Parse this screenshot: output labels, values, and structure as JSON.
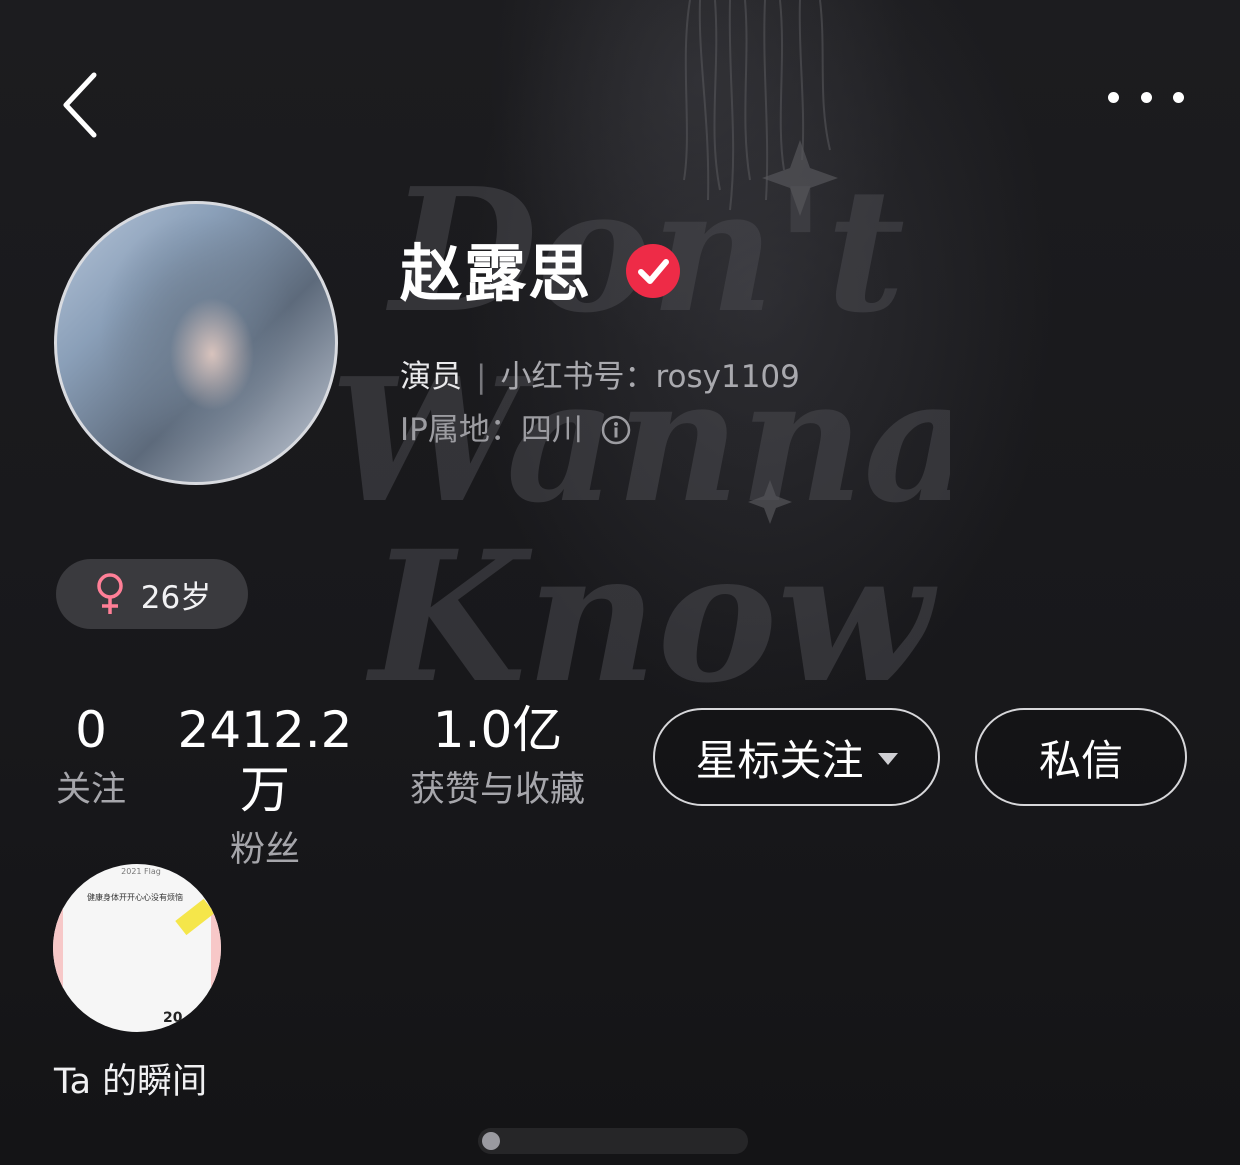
{
  "profile": {
    "name": "赵露思",
    "role": "演员",
    "id_label": "小红书号：",
    "id_value": "rosy1109",
    "ip_label": "IP属地：",
    "ip_value": "四川",
    "tag_age": "26岁"
  },
  "stats": [
    {
      "num": "0",
      "label": "关注"
    },
    {
      "num": "2412.2万",
      "label": "粉丝"
    },
    {
      "num": "1.0亿",
      "label": "获赞与收藏"
    }
  ],
  "actions": {
    "follow_label": "星标关注",
    "message_label": "私信"
  },
  "moments": {
    "label": "Ta 的瞬间",
    "thumb_header": "2021 Flag",
    "thumb_line": "健康身体开开心心没有烦恼",
    "thumb_year": "20"
  },
  "background_art": {
    "words": [
      "Don't",
      "Wanna",
      "Know"
    ]
  },
  "icons": {
    "back": "chevron-left-icon",
    "more": "more-dots-icon",
    "verified": "verified-check-icon",
    "gender": "female-icon",
    "info": "info-icon"
  },
  "colors": {
    "verified": "#ee2b47",
    "female": "#ff7f97",
    "background": "#151517"
  }
}
